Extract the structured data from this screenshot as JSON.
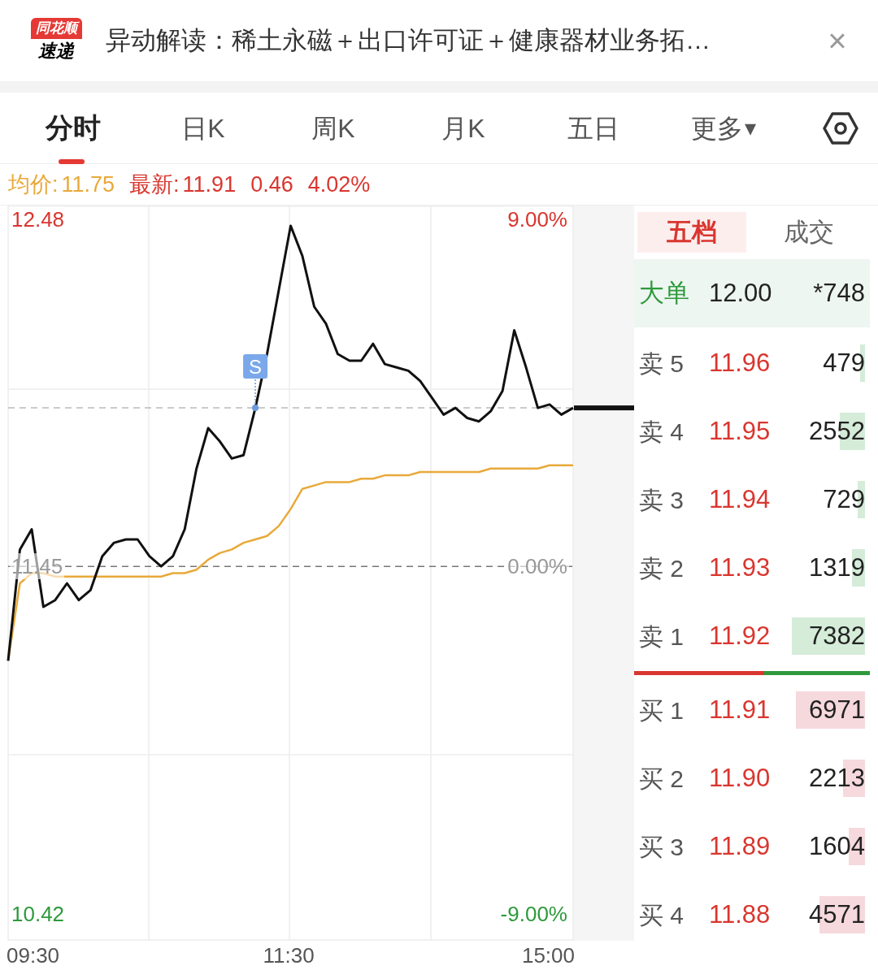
{
  "header": {
    "logo": {
      "top": "同花顺",
      "bottom": "速递"
    },
    "title": "异动解读：稀土永磁＋出口许可证＋健康器材业务拓…",
    "close": "×"
  },
  "tabs": [
    {
      "label": "分时",
      "selected": true
    },
    {
      "label": "日K",
      "selected": false
    },
    {
      "label": "周K",
      "selected": false
    },
    {
      "label": "月K",
      "selected": false
    },
    {
      "label": "五日",
      "selected": false
    },
    {
      "label": "更多",
      "selected": false,
      "caret": "▾"
    }
  ],
  "quote": {
    "avg_label": "均价:",
    "avg": "11.75",
    "last_label": "最新:",
    "last": "11.91",
    "change": "0.46",
    "change_pct": "4.02%"
  },
  "chart": {
    "chart_data": {
      "type": "line",
      "categories": [
        null,
        null,
        null,
        null,
        null,
        null,
        null,
        null,
        null,
        null,
        null,
        null,
        null,
        null,
        null,
        null,
        null,
        null,
        null,
        null,
        null,
        null,
        null,
        null,
        null,
        null,
        null,
        null,
        null,
        null,
        null,
        null,
        null,
        null,
        null,
        null,
        null,
        null,
        null,
        null,
        null,
        null,
        null,
        null,
        null,
        null,
        null,
        null,
        null
      ],
      "series": [
        {
          "color": "#111111",
          "line_style": "solid",
          "values": [
            11.17,
            11.5,
            11.56,
            11.33,
            11.35,
            11.4,
            11.35,
            11.38,
            11.48,
            11.52,
            11.53,
            11.53,
            11.48,
            11.45,
            11.48,
            11.56,
            11.74,
            11.86,
            11.82,
            11.77,
            11.78,
            11.92,
            12.08,
            12.27,
            12.46,
            12.37,
            12.22,
            12.17,
            12.08,
            12.06,
            12.06,
            12.11,
            12.05,
            12.04,
            12.03,
            12.0,
            11.95,
            11.9,
            11.92,
            11.89,
            11.88,
            11.91,
            11.97,
            12.15,
            12.04,
            11.92,
            11.93,
            11.9,
            11.92
          ]
        },
        {
          "color": "#e8a93a",
          "line_style": "solid",
          "values": [
            11.17,
            11.4,
            11.43,
            11.43,
            11.42,
            11.42,
            11.42,
            11.42,
            11.42,
            11.42,
            11.42,
            11.42,
            11.42,
            11.42,
            11.43,
            11.43,
            11.44,
            11.47,
            11.49,
            11.5,
            11.52,
            11.53,
            11.54,
            11.57,
            11.62,
            11.68,
            11.69,
            11.7,
            11.7,
            11.7,
            11.71,
            11.71,
            11.72,
            11.72,
            11.72,
            11.73,
            11.73,
            11.73,
            11.73,
            11.73,
            11.73,
            11.74,
            11.74,
            11.74,
            11.74,
            11.74,
            11.75,
            11.75,
            11.75
          ]
        },
        {
          "color": "#777777",
          "line_style": "dashed",
          "values": [
            11.45,
            11.45,
            11.45,
            11.45,
            11.45,
            11.45,
            11.45,
            11.45,
            11.45,
            11.45,
            11.45,
            11.45,
            11.45,
            11.45,
            11.45,
            11.45,
            11.45,
            11.45,
            11.45,
            11.45,
            11.45,
            11.45,
            11.45,
            11.45,
            11.45,
            11.45,
            11.45,
            11.45,
            11.45,
            11.45,
            11.45,
            11.45,
            11.45,
            11.45,
            11.45,
            11.45,
            11.45,
            11.45,
            11.45,
            11.45,
            11.45,
            11.45,
            11.45,
            11.45,
            11.45,
            11.45,
            11.45,
            11.45,
            11.45
          ]
        },
        {
          "color": "#bbbbbb",
          "line_style": "dashed",
          "values": [
            11.92,
            11.92,
            11.92,
            11.92,
            11.92,
            11.92,
            11.92,
            11.92,
            11.92,
            11.92,
            11.92,
            11.92,
            11.92,
            11.92,
            11.92,
            11.92,
            11.92,
            11.92,
            11.92,
            11.92,
            11.92,
            11.92,
            11.92,
            11.92,
            11.92,
            11.92,
            11.92,
            11.92,
            11.92,
            11.92,
            11.92,
            11.92,
            11.92,
            11.92,
            11.92,
            11.92,
            11.92,
            11.92,
            11.92,
            11.92,
            11.92,
            11.92,
            11.92,
            11.92,
            11.92,
            11.92,
            11.92,
            11.92,
            11.92
          ]
        }
      ],
      "ylim": [
        10.34,
        12.52
      ],
      "grid": true,
      "yticks": [
        {
          "value": 12.48,
          "label": "12.48"
        },
        {
          "value": 11.45,
          "label": "11.45"
        },
        {
          "value": 10.42,
          "label": "10.42"
        }
      ],
      "annotations": [
        {
          "text": "S",
          "y": 11.92
        }
      ]
    },
    "right_labels": [
      "9.00%",
      "0.00%",
      "-9.00%"
    ],
    "time_labels": [
      "09:30",
      "11:30",
      "15:00"
    ]
  },
  "book": {
    "tabs": [
      {
        "label": "五档",
        "selected": true
      },
      {
        "label": "成交",
        "selected": false
      }
    ],
    "rows": [
      {
        "kind": "big",
        "label": "大单",
        "price": "12.00",
        "volume": "*748"
      },
      {
        "kind": "ask",
        "label": "卖 5",
        "price": "11.96",
        "volume": "479"
      },
      {
        "kind": "ask",
        "label": "卖 4",
        "price": "11.95",
        "volume": "2552"
      },
      {
        "kind": "ask",
        "label": "卖 3",
        "price": "11.94",
        "volume": "729"
      },
      {
        "kind": "ask",
        "label": "卖 2",
        "price": "11.93",
        "volume": "1319"
      },
      {
        "kind": "ask",
        "label": "卖 1",
        "price": "11.92",
        "volume": "7382"
      },
      {
        "kind": "divider"
      },
      {
        "kind": "bid",
        "label": "买 1",
        "price": "11.91",
        "volume": "6971"
      },
      {
        "kind": "bid",
        "label": "买 2",
        "price": "11.90",
        "volume": "2213"
      },
      {
        "kind": "bid",
        "label": "买 3",
        "price": "11.89",
        "volume": "1604"
      },
      {
        "kind": "bid",
        "label": "买 4",
        "price": "11.88",
        "volume": "4571"
      }
    ]
  }
}
